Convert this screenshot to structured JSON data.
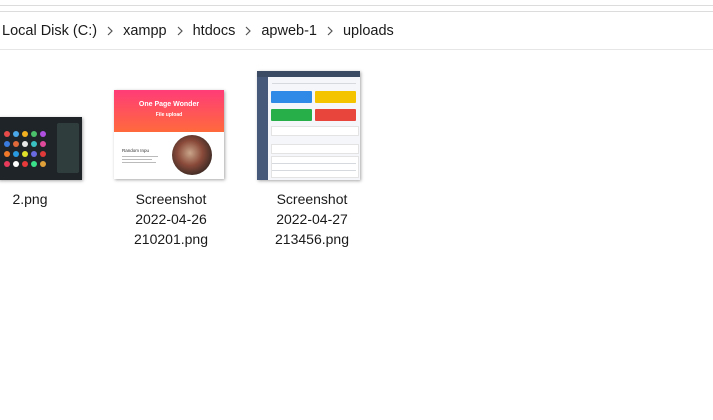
{
  "breadcrumb": {
    "items": [
      "Local Disk (C:)",
      "xampp",
      "htdocs",
      "apweb-1",
      "uploads"
    ]
  },
  "files": [
    {
      "name": "2.png"
    },
    {
      "name": "Screenshot\n2022-04-26\n210201.png"
    },
    {
      "name": "Screenshot\n2022-04-27\n213456.png"
    }
  ],
  "thumbnail_text": {
    "one_page_title": "One Page Wonder",
    "one_page_sub": "File upload",
    "one_page_section": "Random Inpu"
  },
  "colors": {
    "hero_start": "#ff3c78",
    "hero_end": "#ff6a3c",
    "card_blue": "#2e8ae6",
    "card_yellow": "#f5c400",
    "card_green": "#27b04a",
    "card_red": "#e8453c"
  }
}
